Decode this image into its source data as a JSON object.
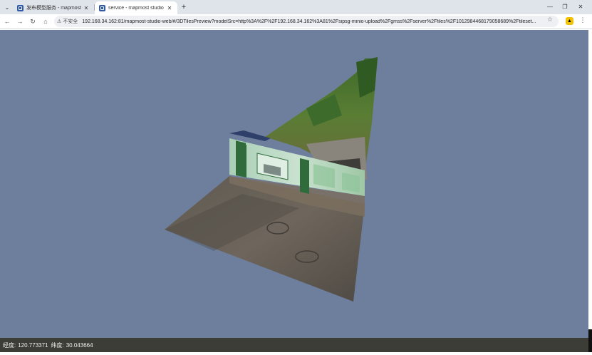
{
  "browser": {
    "tab_menu_icon": "chevron-down-icon",
    "tabs": [
      {
        "title": "发布模型服务 - mapmost",
        "close": "✕"
      },
      {
        "title": "service - mapmost studio",
        "close": "✕"
      }
    ],
    "new_tab": "+",
    "window_controls": {
      "minimize": "—",
      "restore": "❐",
      "close": "✕"
    },
    "security_label": "不安全",
    "url": "192.168.34.162:81/mapmost-studio-web/#/3DTilesPreview?modelSrc=http%3A%2F%2F192.168.34.162%3A81%2Fsipsg-minio-upload%2Fgmss%2Fserver%2Ffiles%2F101298446817905868​9%2Ftileset...",
    "nav": {
      "back": "←",
      "forward": "→",
      "reload": "↻",
      "home": "⌂"
    },
    "star": "☆",
    "kebab": "⋮"
  },
  "viewer": {
    "background": "#6e7f9e",
    "status": {
      "longitude_label": "经度:",
      "longitude": "120.773371",
      "latitude_label": "纬度:",
      "latitude": "30.043664"
    }
  }
}
